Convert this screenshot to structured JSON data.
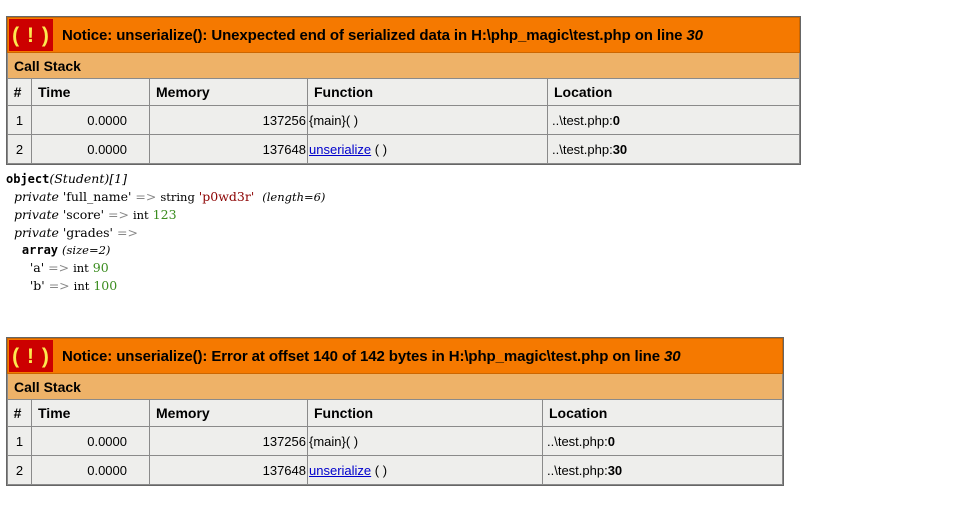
{
  "page": {
    "title": "Xdebug notice output"
  },
  "blocks": [
    {
      "id": "notice-1",
      "icon": "warning-icon",
      "icon_glyph": "( ! )",
      "message_prefix": "Notice: unserialize(): Unexpected end of serialized data in H:\\php_magic\\test.php on line",
      "line_number": "30",
      "callstack_title": "Call Stack",
      "columns": [
        "#",
        "Time",
        "Memory",
        "Function",
        "Location"
      ],
      "rows": [
        {
          "num": "1",
          "time": "0.0000",
          "memory": "137256",
          "function": "{main}( )",
          "function_link": "",
          "function_suffix": "",
          "location_path": "..\\test.php:",
          "location_line": "0"
        },
        {
          "num": "2",
          "time": "0.0000",
          "memory": "137648",
          "function": "",
          "function_link": "unserialize",
          "function_suffix": " ( )",
          "location_path": "..\\test.php:",
          "location_line": "30"
        }
      ]
    },
    {
      "id": "notice-2",
      "icon": "warning-icon",
      "icon_glyph": "( ! )",
      "message_prefix": "Notice: unserialize(): Error at offset 140 of 142 bytes in H:\\php_magic\\test.php on line",
      "line_number": "30",
      "callstack_title": "Call Stack",
      "columns": [
        "#",
        "Time",
        "Memory",
        "Function",
        "Location"
      ],
      "rows": [
        {
          "num": "1",
          "time": "0.0000",
          "memory": "137256",
          "function": "{main}( )",
          "function_link": "",
          "function_suffix": "",
          "location_path": "..\\test.php:",
          "location_line": "0"
        },
        {
          "num": "2",
          "time": "0.0000",
          "memory": "137648",
          "function": "",
          "function_link": "unserialize",
          "function_suffix": " ( )",
          "location_path": "..\\test.php:",
          "location_line": "30"
        }
      ]
    }
  ],
  "vardump": {
    "object_kw": "object",
    "object_class": "(Student)",
    "object_id": "[1]",
    "prop1_vis": "private",
    "prop1_name": "'full_name'",
    "prop1_arrow": "=>",
    "prop1_type": "string",
    "prop1_value": "'p0wd3r'",
    "prop1_meta": "(length=6)",
    "prop2_vis": "private",
    "prop2_name": "'score'",
    "prop2_arrow": "=>",
    "prop2_type": "int",
    "prop2_value": "123",
    "prop3_vis": "private",
    "prop3_name": "'grades'",
    "prop3_arrow": "=>",
    "array_kw": "array",
    "array_meta": "(size=2)",
    "item1_key": "'a'",
    "item1_arrow": "=>",
    "item1_type": "int",
    "item1_value": "90",
    "item2_key": "'b'",
    "item2_arrow": "=>",
    "item2_type": "int",
    "item2_value": "100"
  },
  "colors": {
    "banner_bg": "#f57900",
    "icon_bg": "#cc0000",
    "icon_fg": "#fce94f",
    "title_bg": "#eeb268",
    "cell_bg": "#eeeeec",
    "link": "#0000cc",
    "string": "#8b0000",
    "int": "#3a8c1e"
  }
}
